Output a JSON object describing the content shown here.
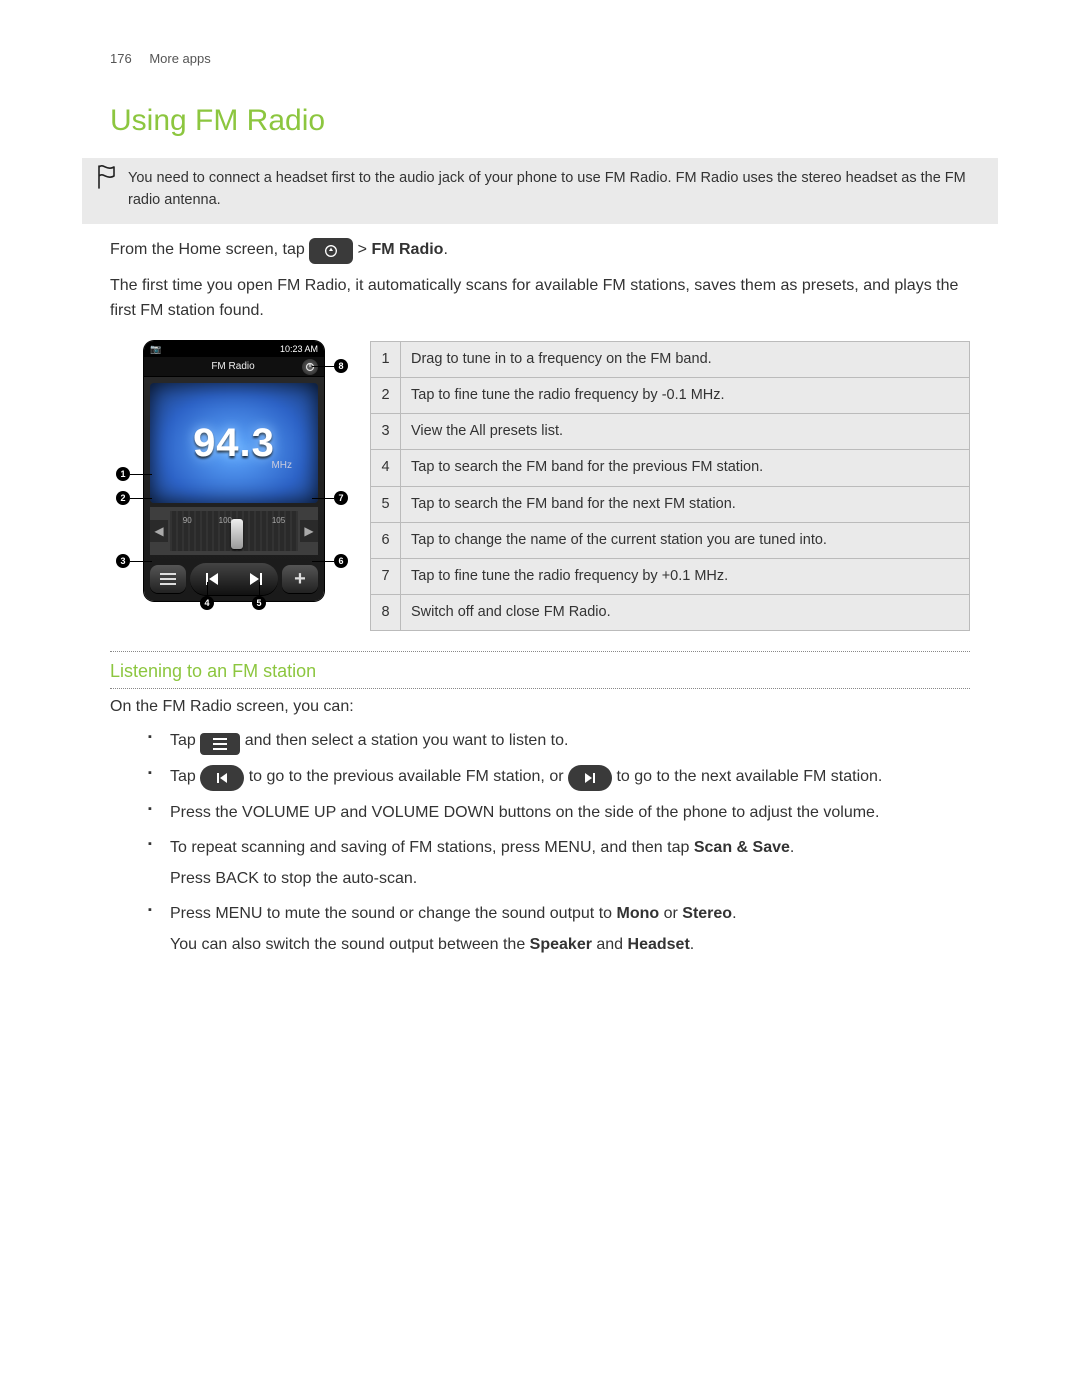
{
  "page_header": {
    "page_number": "176",
    "section": "More apps"
  },
  "title": "Using FM Radio",
  "note": "You need to connect a headset first to the audio jack of your phone to use FM Radio. FM Radio uses the stereo headset as the FM radio antenna.",
  "intro": {
    "line1a": "From the Home screen, tap ",
    "line1b": " > ",
    "line1c": "FM Radio",
    "line1d": ".",
    "line2": "The first time you open FM Radio, it automatically scans for available FM stations, saves them as presets, and plays the first FM station found."
  },
  "phone": {
    "status_time": "10:23 AM",
    "title": "FM Radio",
    "frequency": "94.3",
    "mhz": "MHz",
    "ruler_mid": "100"
  },
  "legend": [
    {
      "n": "1",
      "text": "Drag to tune in to a frequency on the FM band."
    },
    {
      "n": "2",
      "text": "Tap to fine tune the radio frequency by -0.1 MHz."
    },
    {
      "n": "3",
      "text": "View the All presets list."
    },
    {
      "n": "4",
      "text": "Tap to search the FM band for the previous FM station."
    },
    {
      "n": "5",
      "text": "Tap to search the FM band for the next FM station."
    },
    {
      "n": "6",
      "text": "Tap to change the name of the current station you are tuned into."
    },
    {
      "n": "7",
      "text": "Tap to fine tune the radio frequency by +0.1 MHz."
    },
    {
      "n": "8",
      "text": "Switch off and close FM Radio."
    }
  ],
  "subsection_title": "Listening to an FM station",
  "subsection_intro": "On the FM Radio screen, you can:",
  "bullets": {
    "b1a": "Tap ",
    "b1b": " and then select a station you want to listen to.",
    "b2a": "Tap ",
    "b2b": " to go to the previous available FM station, or ",
    "b2c": " to go to the next available FM station.",
    "b3": "Press the VOLUME UP and VOLUME DOWN buttons on the side of the phone to adjust the volume.",
    "b4a": "To repeat scanning and saving of FM stations, press MENU, and then tap ",
    "b4b": "Scan & Save",
    "b4c": ".",
    "b4_sub": "Press BACK to stop the auto-scan.",
    "b5a": "Press MENU to mute the sound or change the sound output to ",
    "b5b": "Mono",
    "b5c": " or ",
    "b5d": "Stereo",
    "b5e": ".",
    "b5_sub_a": "You can also switch the sound output between the ",
    "b5_sub_b": "Speaker",
    "b5_sub_c": " and ",
    "b5_sub_d": "Headset",
    "b5_sub_e": "."
  }
}
